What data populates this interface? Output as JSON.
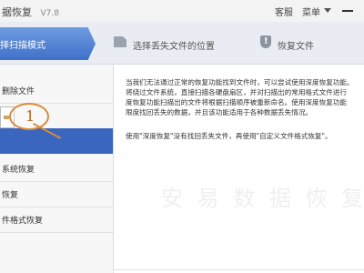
{
  "titlebar": {
    "title": "据恢复",
    "version": "V7.8",
    "service_label": "客服",
    "menu_label": "菜单"
  },
  "steps": [
    {
      "label": "择扫描模式",
      "active": true
    },
    {
      "label": "选择丢失文件的位置",
      "active": false,
      "icon": "document-icon"
    },
    {
      "label": "恢复文件",
      "active": false,
      "icon": "warning-icon"
    }
  ],
  "sidebar": {
    "items": [
      {
        "label": "删除文件"
      },
      {
        "label": ""
      },
      {
        "label": "",
        "active": true
      },
      {
        "label": "系统恢复"
      },
      {
        "label": "恢复"
      },
      {
        "label": "件格式恢复"
      }
    ]
  },
  "callout": {
    "number": "1"
  },
  "content": {
    "description_lines": [
      "当我们无法通过正常的恢复功能找到文件时，可以尝试使用深度恢复功能。",
      "将绕过文件系统，直接扫描各硬盘扇区，并对扫描出的常用格式文件进行",
      "度恢复功能扫描出的文件将根据扫描顺序被重新命名。使用深度恢复功能",
      "限度找回丢失的数据，并且该功能适用于各种数据丢失情况。"
    ],
    "hint": "使用\"深度恢复\"没有找回丢失文件，再使用\"自定义文件格式恢复\"。",
    "watermark": "安 易 数 据 恢 复"
  },
  "colors": {
    "accent": "#3a66c0",
    "callout": "#d98c3a"
  }
}
